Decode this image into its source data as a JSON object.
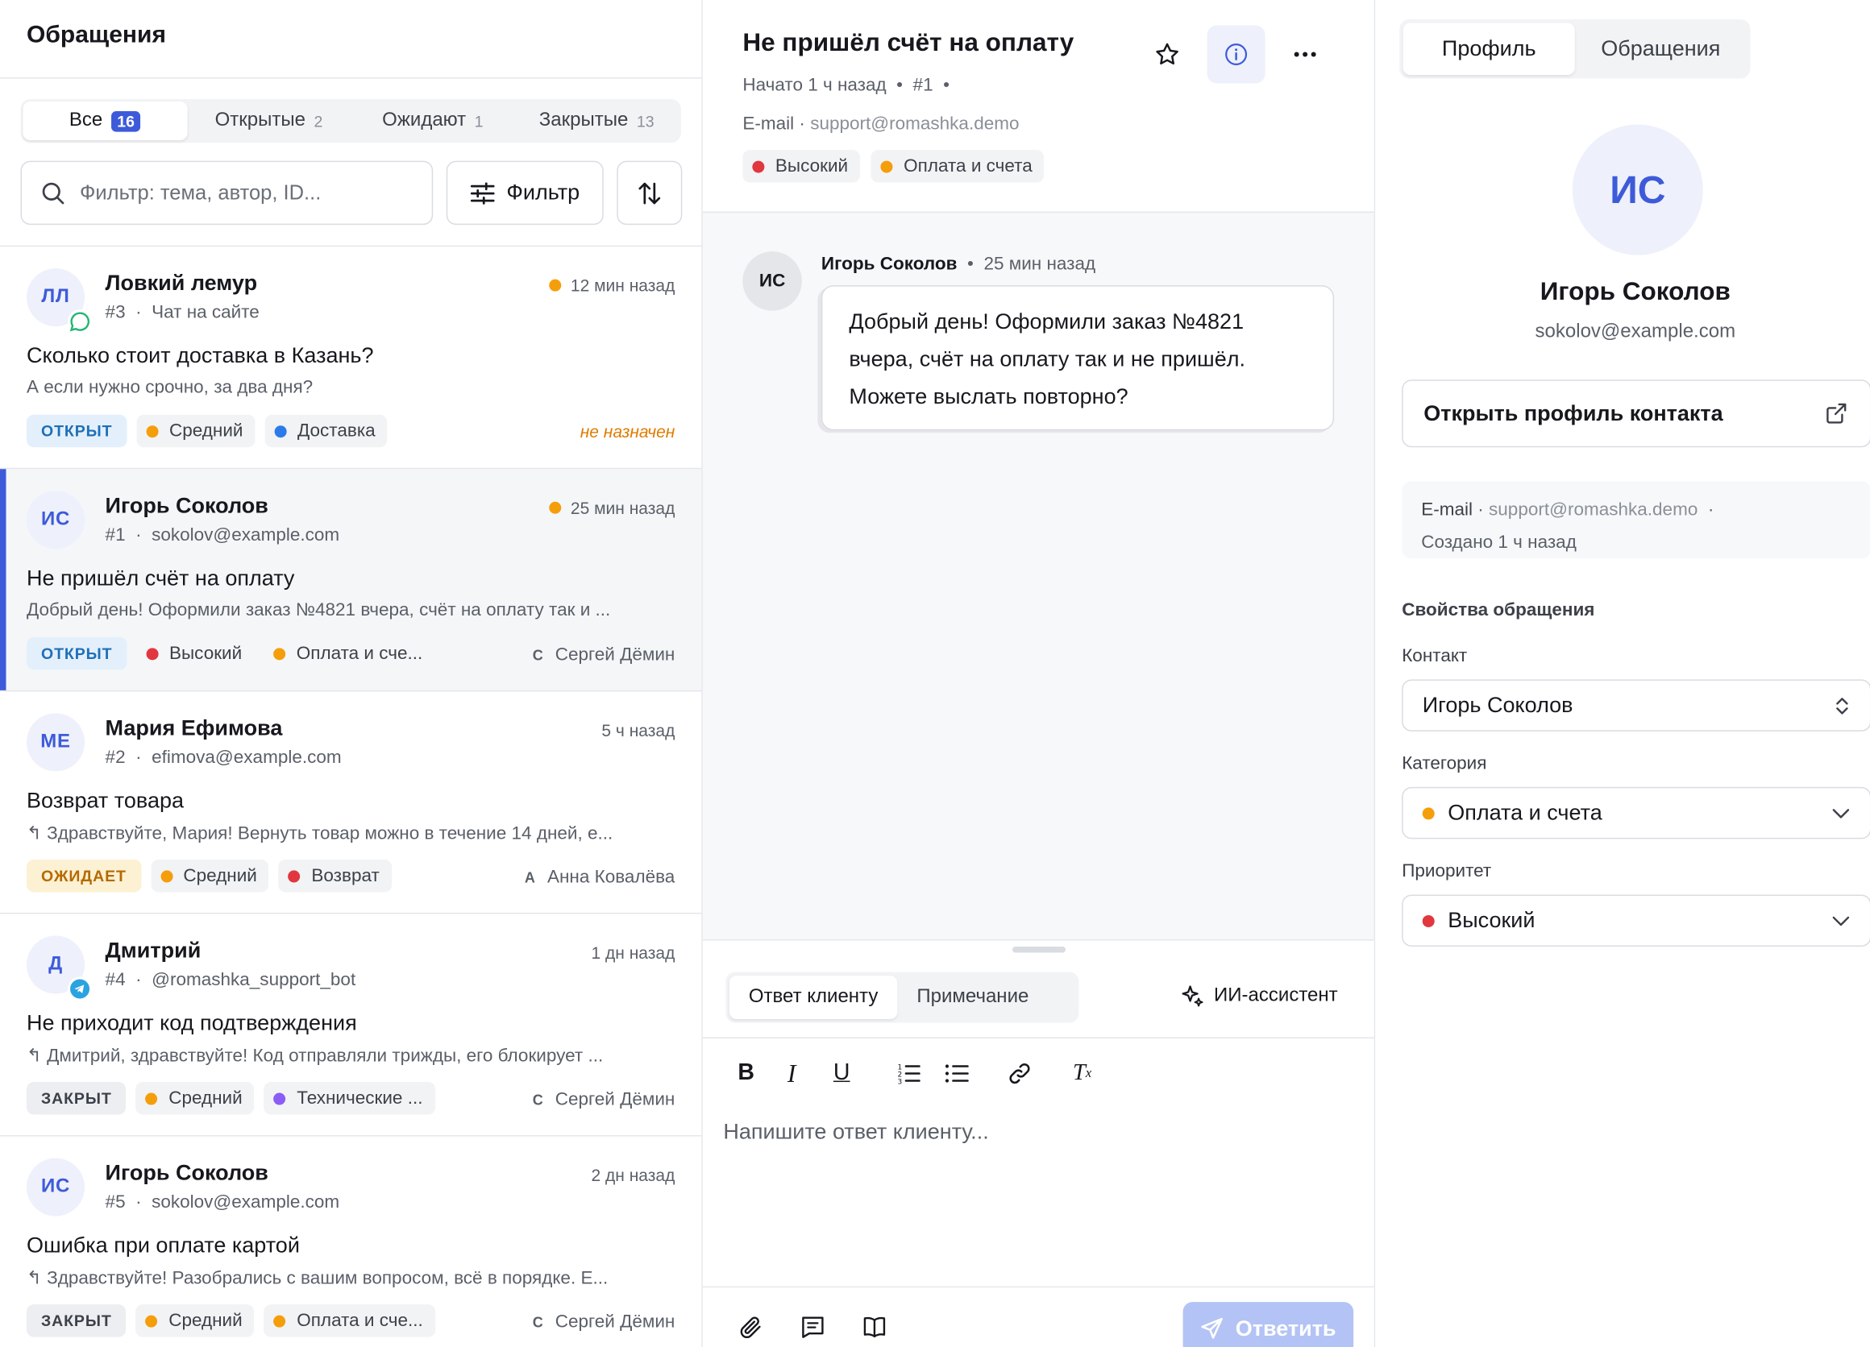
{
  "colors": {
    "accent": "#3d5bd9",
    "high": "#e0383e",
    "medium": "#f59e0b",
    "blue": "#2b7bea",
    "violet": "#8b5cf6"
  },
  "left": {
    "title": "Обращения",
    "tabs": [
      {
        "label": "Все",
        "count": "16"
      },
      {
        "label": "Открытые",
        "count": "2"
      },
      {
        "label": "Ожидают",
        "count": "1"
      },
      {
        "label": "Закрытые",
        "count": "13"
      }
    ],
    "search_placeholder": "Фильтр: тема, автор, ID...",
    "filter_label": "Фильтр",
    "tickets": [
      {
        "initials": "ЛЛ",
        "name": "Ловкий лемур",
        "id": "#3",
        "source": "Чат на сайте",
        "time": "12 мин назад",
        "subject": "Сколько стоит доставка в Казань?",
        "preview": "А если нужно срочно, за два дня?",
        "status": "ОТКРЫТ",
        "priority": "Средний",
        "category": "Доставка",
        "assignee_initial": "",
        "assignee": "не назначен",
        "badge": "chat-icon"
      },
      {
        "initials": "ИС",
        "name": "Игорь Соколов",
        "id": "#1",
        "source": "sokolov@example.com",
        "time": "25 мин назад",
        "subject": "Не пришёл счёт на оплату",
        "preview": "Добрый день! Оформили заказ №4821 вчера, счёт на оплату так и ...",
        "status": "ОТКРЫТ",
        "priority": "Высокий",
        "category": "Оплата и сче...",
        "assignee_initial": "С",
        "assignee": "Сергей Дёмин",
        "badge": ""
      },
      {
        "initials": "МЕ",
        "name": "Мария Ефимова",
        "id": "#2",
        "source": "efimova@example.com",
        "time": "5 ч назад",
        "subject": "Возврат товара",
        "preview": "Здравствуйте, Мария! Вернуть товар можно в течение 14 дней, е...",
        "status": "ОЖИДАЕТ",
        "priority": "Средний",
        "category": "Возврат",
        "assignee_initial": "А",
        "assignee": "Анна Ковалёва",
        "badge": ""
      },
      {
        "initials": "Д",
        "name": "Дмитрий",
        "id": "#4",
        "source": "@romashka_support_bot",
        "time": "1 дн назад",
        "subject": "Не приходит код подтверждения",
        "preview": "Дмитрий, здравствуйте! Код отправляли трижды, его блокирует ...",
        "status": "ЗАКРЫТ",
        "priority": "Средний",
        "category": "Технические ...",
        "assignee_initial": "С",
        "assignee": "Сергей Дёмин",
        "badge": "telegram-icon"
      },
      {
        "initials": "ИС",
        "name": "Игорь Соколов",
        "id": "#5",
        "source": "sokolov@example.com",
        "time": "2 дн назад",
        "subject": "Ошибка при оплате картой",
        "preview": "Здравствуйте! Разобрались с вашим вопросом, всё в порядке. Е...",
        "status": "ЗАКРЫТ",
        "priority": "Средний",
        "category": "Оплата и сче...",
        "assignee_initial": "С",
        "assignee": "Сергей Дёмин",
        "badge": ""
      }
    ]
  },
  "mid": {
    "title": "Не пришёл счёт на оплату",
    "started": "Начато 1 ч назад",
    "ticket_id": "#1",
    "email_label": "E-mail",
    "email_value": "support@romashka.demo",
    "priority": "Высокий",
    "category": "Оплата и счета",
    "message": {
      "initials": "ИС",
      "author": "Игорь Соколов",
      "time": "25 мин назад",
      "text": "Добрый день! Оформили заказ №4821 вчера, счёт на оплату так и не пришёл. Можете выслать повторно?"
    },
    "reply_tabs": [
      "Ответ клиенту",
      "Примечание"
    ],
    "ai_label": "ИИ-ассистент",
    "reply_placeholder": "Напишите ответ клиенту...",
    "send_label": "Ответить"
  },
  "right": {
    "tabs": [
      "Профиль",
      "Обращения"
    ],
    "initials": "ИС",
    "name": "Игорь Соколов",
    "email": "sokolov@example.com",
    "open_profile": "Открыть профиль контакта",
    "channel_label": "E-mail",
    "channel_value": "support@romashka.demo",
    "created": "Создано 1 ч назад",
    "section_title": "Свойства обращения",
    "contact_label": "Контакт",
    "contact_value": "Игорь Соколов",
    "category_label": "Категория",
    "category_value": "Оплата и счета",
    "priority_label": "Приоритет",
    "priority_value": "Высокий"
  }
}
